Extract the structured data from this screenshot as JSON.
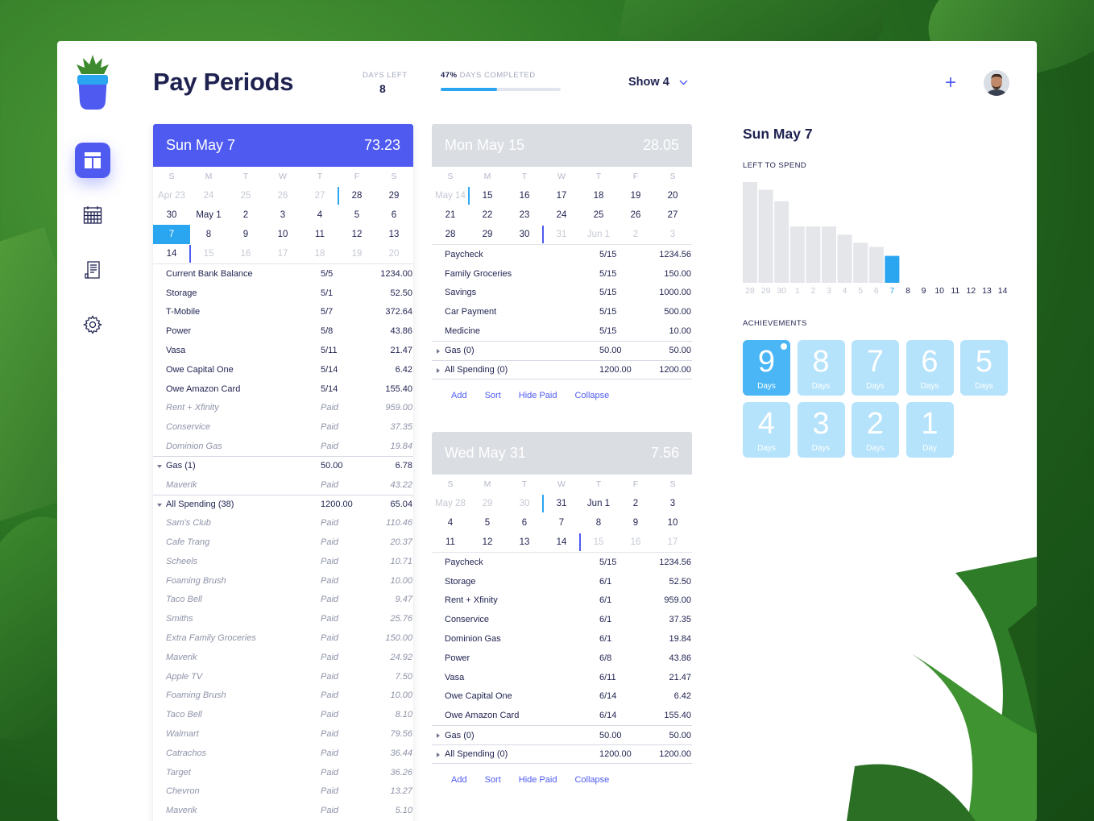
{
  "header": {
    "title": "Pay Periods",
    "days_left_label": "DAYS LEFT",
    "days_left_value": "8",
    "progress_percent_text": "47%",
    "progress_label": "DAYS COMPLETED",
    "progress_fraction": 0.47,
    "show_label": "Show 4"
  },
  "colors": {
    "accent": "#4f5bf0",
    "blue": "#2aa5f0",
    "header_inactive": "#dadde2"
  },
  "icons": [
    "plant-logo-icon",
    "columns-icon",
    "calendar-icon",
    "receipt-icon",
    "gear-icon",
    "plus-icon",
    "chevron-down-icon",
    "avatar"
  ],
  "dow": [
    "S",
    "M",
    "T",
    "W",
    "T",
    "F",
    "S"
  ],
  "panel1": {
    "date": "Sun May 7",
    "amount": "73.23",
    "calendar": [
      [
        "Apr 23",
        "24",
        "25",
        "26",
        "27",
        "28",
        "29"
      ],
      [
        "30",
        "May 1",
        "2",
        "3",
        "4",
        "5",
        "6"
      ],
      [
        "7",
        "8",
        "9",
        "10",
        "11",
        "12",
        "13"
      ],
      [
        "14",
        "15",
        "16",
        "17",
        "18",
        "19",
        "20"
      ]
    ],
    "rows": [
      {
        "name": "Current Bank Balance",
        "date": "5/5",
        "amount": "1234.00"
      },
      {
        "name": "Storage",
        "date": "5/1",
        "amount": "52.50"
      },
      {
        "name": "T-Mobile",
        "date": "5/7",
        "amount": "372.64"
      },
      {
        "name": "Power",
        "date": "5/8",
        "amount": "43.86"
      },
      {
        "name": "Vasa",
        "date": "5/11",
        "amount": "21.47"
      },
      {
        "name": "Owe Capital One",
        "date": "5/14",
        "amount": "6.42"
      },
      {
        "name": "Owe Amazon Card",
        "date": "5/14",
        "amount": "155.40"
      },
      {
        "name": "Rent + Xfinity",
        "date": "Paid",
        "amount": "959.00"
      },
      {
        "name": "Conservice",
        "date": "Paid",
        "amount": "37.35"
      },
      {
        "name": "Dominion Gas",
        "date": "Paid",
        "amount": "19.84"
      },
      {
        "name": "Gas (1)",
        "date": "50.00",
        "amount": "6.78"
      },
      {
        "name": "Maverik",
        "date": "Paid",
        "amount": "43.22"
      },
      {
        "name": "All Spending (38)",
        "date": "1200.00",
        "amount": "65.04"
      },
      {
        "name": "Sam's Club",
        "date": "Paid",
        "amount": "110.46"
      },
      {
        "name": "Cafe Trang",
        "date": "Paid",
        "amount": "20.37"
      },
      {
        "name": "Scheels",
        "date": "Paid",
        "amount": "10.71"
      },
      {
        "name": "Foaming Brush",
        "date": "Paid",
        "amount": "10.00"
      },
      {
        "name": "Taco Bell",
        "date": "Paid",
        "amount": "9.47"
      },
      {
        "name": "Smiths",
        "date": "Paid",
        "amount": "25.76"
      },
      {
        "name": "Extra Family Groceries",
        "date": "Paid",
        "amount": "150.00"
      },
      {
        "name": "Maverik",
        "date": "Paid",
        "amount": "24.92"
      },
      {
        "name": "Apple TV",
        "date": "Paid",
        "amount": "7.50"
      },
      {
        "name": "Foaming Brush",
        "date": "Paid",
        "amount": "10.00"
      },
      {
        "name": "Taco Bell",
        "date": "Paid",
        "amount": "8.10"
      },
      {
        "name": "Walmart",
        "date": "Paid",
        "amount": "79.56"
      },
      {
        "name": "Catrachos",
        "date": "Paid",
        "amount": "36.44"
      },
      {
        "name": "Target",
        "date": "Paid",
        "amount": "36.26"
      },
      {
        "name": "Chevron",
        "date": "Paid",
        "amount": "13.27"
      },
      {
        "name": "Maverik",
        "date": "Paid",
        "amount": "5.10"
      }
    ]
  },
  "panel2": {
    "date": "Mon May 15",
    "amount": "28.05",
    "calendar": [
      [
        "May 14",
        "15",
        "16",
        "17",
        "18",
        "19",
        "20"
      ],
      [
        "21",
        "22",
        "23",
        "24",
        "25",
        "26",
        "27"
      ],
      [
        "28",
        "29",
        "30",
        "31",
        "Jun 1",
        "2",
        "3"
      ]
    ],
    "rows": [
      {
        "name": "Paycheck",
        "date": "5/15",
        "amount": "1234.56"
      },
      {
        "name": "Family Groceries",
        "date": "5/15",
        "amount": "150.00"
      },
      {
        "name": "Savings",
        "date": "5/15",
        "amount": "1000.00"
      },
      {
        "name": "Car Payment",
        "date": "5/15",
        "amount": "500.00"
      },
      {
        "name": "Medicine",
        "date": "5/15",
        "amount": "10.00"
      },
      {
        "name": "Gas (0)",
        "date": "50.00",
        "amount": "50.00"
      },
      {
        "name": "All Spending (0)",
        "date": "1200.00",
        "amount": "1200.00"
      }
    ],
    "actions": [
      "Add",
      "Sort",
      "Hide Paid",
      "Collapse"
    ]
  },
  "panel3": {
    "date": "Wed May 31",
    "amount": "7.56",
    "calendar": [
      [
        "May 28",
        "29",
        "30",
        "31",
        "Jun 1",
        "2",
        "3"
      ],
      [
        "4",
        "5",
        "6",
        "7",
        "8",
        "9",
        "10"
      ],
      [
        "11",
        "12",
        "13",
        "14",
        "15",
        "16",
        "17"
      ]
    ],
    "rows": [
      {
        "name": "Paycheck",
        "date": "5/15",
        "amount": "1234.56"
      },
      {
        "name": "Storage",
        "date": "6/1",
        "amount": "52.50"
      },
      {
        "name": "Rent + Xfinity",
        "date": "6/1",
        "amount": "959.00"
      },
      {
        "name": "Conservice",
        "date": "6/1",
        "amount": "37.35"
      },
      {
        "name": "Dominion Gas",
        "date": "6/1",
        "amount": "19.84"
      },
      {
        "name": "Power",
        "date": "6/8",
        "amount": "43.86"
      },
      {
        "name": "Vasa",
        "date": "6/11",
        "amount": "21.47"
      },
      {
        "name": "Owe Capital One",
        "date": "6/14",
        "amount": "6.42"
      },
      {
        "name": "Owe Amazon Card",
        "date": "6/14",
        "amount": "155.40"
      },
      {
        "name": "Gas (0)",
        "date": "50.00",
        "amount": "50.00"
      },
      {
        "name": "All Spending (0)",
        "date": "1200.00",
        "amount": "1200.00"
      }
    ],
    "actions": [
      "Add",
      "Sort",
      "Hide Paid",
      "Collapse"
    ]
  },
  "side": {
    "title": "Sun May 7",
    "left_to_spend_label": "LEFT TO SPEND",
    "achievements_label": "ACHIEVEMENTS",
    "achievements": [
      {
        "num": "9",
        "label": "Days"
      },
      {
        "num": "8",
        "label": "Days"
      },
      {
        "num": "7",
        "label": "Days"
      },
      {
        "num": "6",
        "label": "Days"
      },
      {
        "num": "5",
        "label": "Days"
      },
      {
        "num": "4",
        "label": "Days"
      },
      {
        "num": "3",
        "label": "Days"
      },
      {
        "num": "2",
        "label": "Days"
      },
      {
        "num": "1",
        "label": "Day"
      }
    ]
  },
  "chart_data": {
    "type": "bar",
    "title": "LEFT TO SPEND",
    "categories": [
      "28",
      "29",
      "30",
      "1",
      "2",
      "3",
      "4",
      "5",
      "6",
      "7",
      "8",
      "9",
      "10",
      "11",
      "12",
      "13",
      "14"
    ],
    "values": [
      1234,
      1140,
      1000,
      690,
      690,
      690,
      590,
      490,
      440,
      330,
      null,
      null,
      null,
      null,
      null,
      null,
      null
    ],
    "highlight_category": "7",
    "grid": false
  }
}
